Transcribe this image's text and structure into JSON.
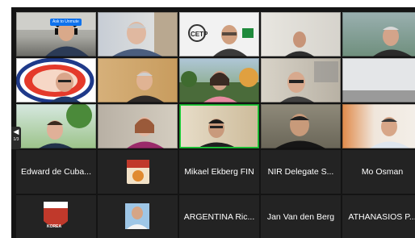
{
  "pager": {
    "page_indicator": "1/3"
  },
  "tiles": {
    "ask_badge": "Ask to Unmute",
    "cetp_logo": "CETP",
    "name_r4_1": "Edward de Cuba...",
    "name_r4_3": "Mikael Ekberg FIN",
    "name_r4_4": "NIR  Delegate S...",
    "name_r4_5": "Mo Osman",
    "name_r5_3": "ARGENTINA Ric...",
    "name_r5_4": "Jan Van den Berg",
    "name_r5_5": "ATHANASIOS P...",
    "korea_logo": "KOREA"
  },
  "colors": {
    "gallery_bg": "#141414",
    "tile_bg": "#232323",
    "active_speaker": "#1fcf3a",
    "badge_blue": "#0e72ed"
  }
}
